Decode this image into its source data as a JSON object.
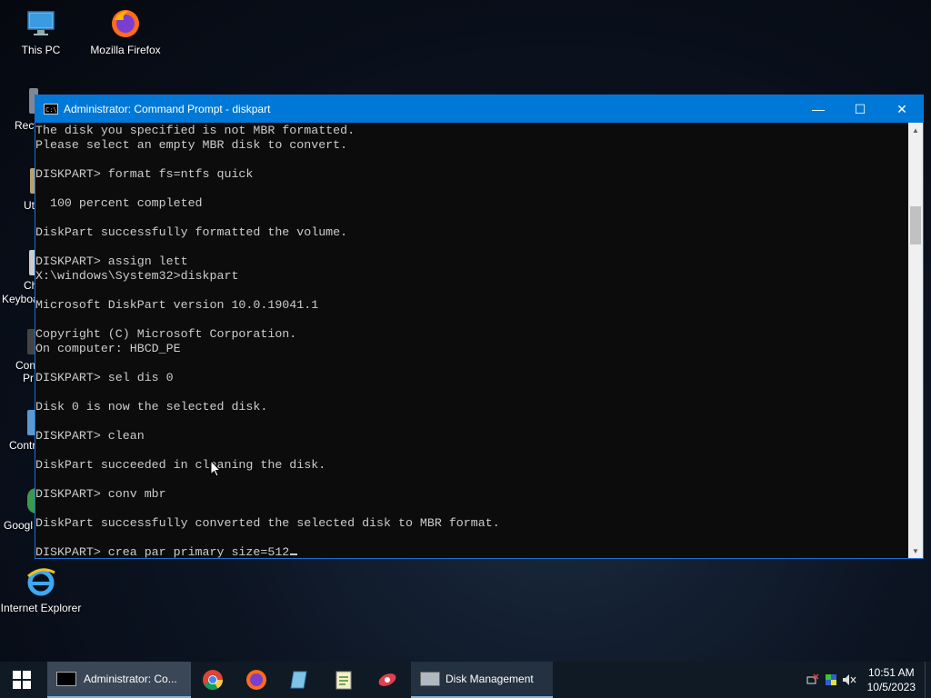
{
  "desktop": {
    "icons": [
      {
        "label": "This PC",
        "icon": "this-pc-icon"
      },
      {
        "label": "Mozilla Firefox",
        "icon": "firefox-icon"
      },
      {
        "label": "Internet Explorer",
        "icon": "internet-explorer-icon"
      }
    ],
    "partial_labels": [
      "Recy",
      "Uti",
      "Ch",
      "Keyboa",
      "Con",
      "Pr",
      "Contr",
      "Googl"
    ]
  },
  "window": {
    "title": "Administrator: Command Prompt - diskpart",
    "controls": {
      "minimize": "—",
      "maximize": "☐",
      "close": "✕"
    },
    "console_lines": [
      "The disk you specified is not MBR formatted.",
      "Please select an empty MBR disk to convert.",
      "",
      "DISKPART> format fs=ntfs quick",
      "",
      "  100 percent completed",
      "",
      "DiskPart successfully formatted the volume.",
      "",
      "DISKPART> assign lett",
      "X:\\windows\\System32>diskpart",
      "",
      "Microsoft DiskPart version 10.0.19041.1",
      "",
      "Copyright (C) Microsoft Corporation.",
      "On computer: HBCD_PE",
      "",
      "DISKPART> sel dis 0",
      "",
      "Disk 0 is now the selected disk.",
      "",
      "DISKPART> clean",
      "",
      "DiskPart succeeded in cleaning the disk.",
      "",
      "DISKPART> conv mbr",
      "",
      "DiskPart successfully converted the selected disk to MBR format.",
      "",
      "DISKPART> crea par primary size=512"
    ]
  },
  "taskbar": {
    "active_task": "Administrator: Co...",
    "open_task": "Disk Management",
    "pinned": [
      "chrome-icon",
      "firefox-icon",
      "notepad-icon",
      "notepad-plus-icon",
      "tool-icon"
    ],
    "clock": {
      "time": "10:51 AM",
      "date": "10/5/2023"
    },
    "colors": {
      "taskbar": "#101a24",
      "accent": "#0078d7"
    }
  }
}
